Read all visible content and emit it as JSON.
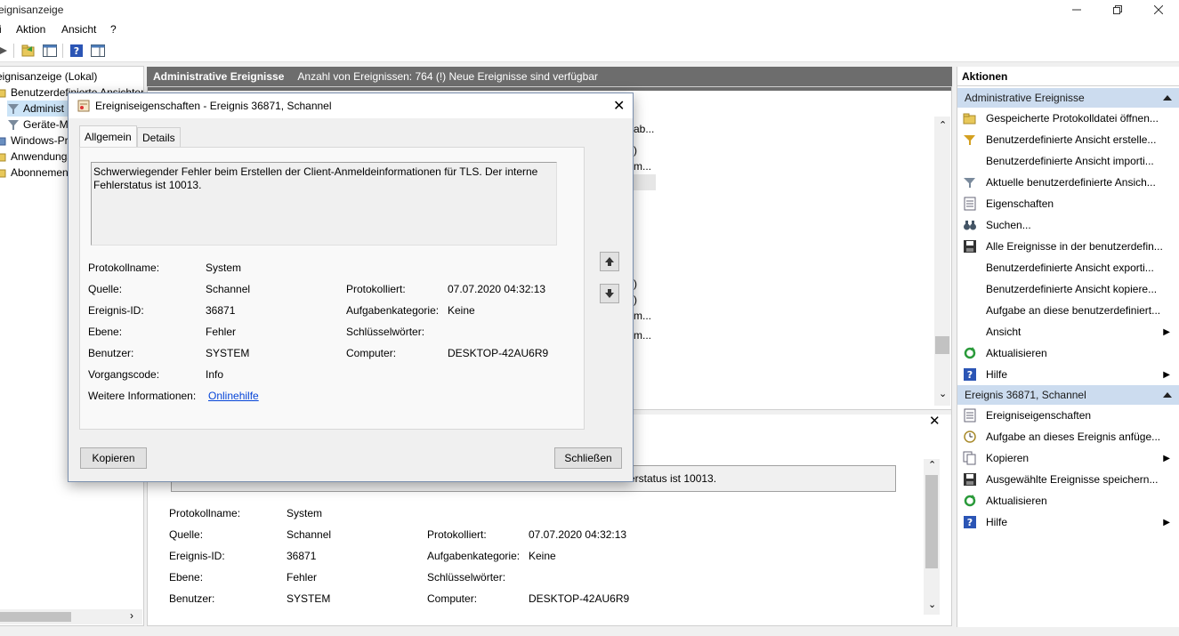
{
  "window": {
    "title": "eignisanzeige"
  },
  "menu": {
    "items": [
      "i",
      "Aktion",
      "Ansicht",
      "?"
    ]
  },
  "tree": {
    "items": [
      {
        "label": "eignisanzeige (Lokal)",
        "icon": "eventviewer-icon"
      },
      {
        "label": "Benutzerdefinierte Ansichten",
        "icon": "folder-icon"
      },
      {
        "label": "Administ",
        "icon": "filter-icon"
      },
      {
        "label": "Geräte-M",
        "icon": "filter-icon"
      },
      {
        "label": "Windows-Pr",
        "icon": "folder-icon"
      },
      {
        "label": "Anwendungs",
        "icon": "folder-icon"
      },
      {
        "label": "Abonnemen",
        "icon": "folder-icon"
      }
    ]
  },
  "center": {
    "header_title": "Administrative Ereignisse",
    "header_info": "Anzahl von Ereignissen: 764 (!) Neue Ereignisse sind verfügbar",
    "list_fragments": [
      "ab...",
      ")",
      "m...",
      ")",
      ")",
      "m...",
      "m..."
    ],
    "detail_partial": "erstatus ist 10013.",
    "detail": {
      "protokollname_label": "Protokollname:",
      "protokollname": "System",
      "quelle_label": "Quelle:",
      "quelle": "Schannel",
      "protokolliert_label": "Protokolliert:",
      "protokolliert": "07.07.2020 04:32:13",
      "ereignisid_label": "Ereignis-ID:",
      "ereignisid": "36871",
      "aufgabe_label": "Aufgabenkategorie:",
      "aufgabe": "Keine",
      "ebene_label": "Ebene:",
      "ebene": "Fehler",
      "schluessel_label": "Schlüsselwörter:",
      "benutzer_label": "Benutzer:",
      "benutzer": "SYSTEM",
      "computer_label": "Computer:",
      "computer": "DESKTOP-42AU6R9"
    }
  },
  "actions": {
    "header": "Aktionen",
    "section1": "Administrative Ereignisse",
    "items1": [
      {
        "label": "Gespeicherte Protokolldatei öffnen...",
        "icon": "open-folder-icon"
      },
      {
        "label": "Benutzerdefinierte Ansicht erstelle...",
        "icon": "filter-create-icon"
      },
      {
        "label": "Benutzerdefinierte Ansicht importi...",
        "icon": ""
      },
      {
        "label": "Aktuelle benutzerdefinierte Ansich...",
        "icon": "filter-icon"
      },
      {
        "label": "Eigenschaften",
        "icon": "properties-icon"
      },
      {
        "label": "Suchen...",
        "icon": "binoculars-icon"
      },
      {
        "label": "Alle Ereignisse in der benutzerdefin...",
        "icon": "save-icon"
      },
      {
        "label": "Benutzerdefinierte Ansicht exporti...",
        "icon": ""
      },
      {
        "label": "Benutzerdefinierte Ansicht kopiere...",
        "icon": ""
      },
      {
        "label": "Aufgabe an diese benutzerdefiniert...",
        "icon": ""
      },
      {
        "label": "Ansicht",
        "icon": "",
        "submenu": true
      },
      {
        "label": "Aktualisieren",
        "icon": "refresh-icon"
      },
      {
        "label": "Hilfe",
        "icon": "help-icon",
        "submenu": true
      }
    ],
    "section2": "Ereignis 36871, Schannel",
    "items2": [
      {
        "label": "Ereigniseigenschaften",
        "icon": "properties-icon"
      },
      {
        "label": "Aufgabe an dieses Ereignis anfüge...",
        "icon": "task-icon"
      },
      {
        "label": "Kopieren",
        "icon": "copy-icon",
        "submenu": true
      },
      {
        "label": "Ausgewählte Ereignisse speichern...",
        "icon": "save-icon"
      },
      {
        "label": "Aktualisieren",
        "icon": "refresh-icon"
      },
      {
        "label": "Hilfe",
        "icon": "help-icon",
        "submenu": true
      }
    ]
  },
  "dialog": {
    "title": "Ereigniseigenschaften - Ereignis 36871, Schannel",
    "tabs": [
      "Allgemein",
      "Details"
    ],
    "message": "Schwerwiegender Fehler beim Erstellen der Client-Anmeldeinformationen für TLS. Der interne Fehlerstatus ist 10013.",
    "protokollname_label": "Protokollname:",
    "protokollname": "System",
    "quelle_label": "Quelle:",
    "quelle": "Schannel",
    "protokolliert_label": "Protokolliert:",
    "protokolliert": "07.07.2020 04:32:13",
    "ereignisid_label": "Ereignis-ID:",
    "ereignisid": "36871",
    "aufgabe_label": "Aufgabenkategorie:",
    "aufgabe": "Keine",
    "ebene_label": "Ebene:",
    "ebene": "Fehler",
    "schluessel_label": "Schlüsselwörter:",
    "benutzer_label": "Benutzer:",
    "benutzer": "SYSTEM",
    "computer_label": "Computer:",
    "computer": "DESKTOP-42AU6R9",
    "vorgang_label": "Vorgangscode:",
    "vorgang": "Info",
    "weitere_label": "Weitere Informationen:",
    "weitere_link": "Onlinehilfe",
    "copy_button": "Kopieren",
    "close_button": "Schließen"
  },
  "colors": {
    "section_bg": "#ccdcef",
    "header_bg": "#6d6d6d",
    "link": "#0645d8"
  }
}
